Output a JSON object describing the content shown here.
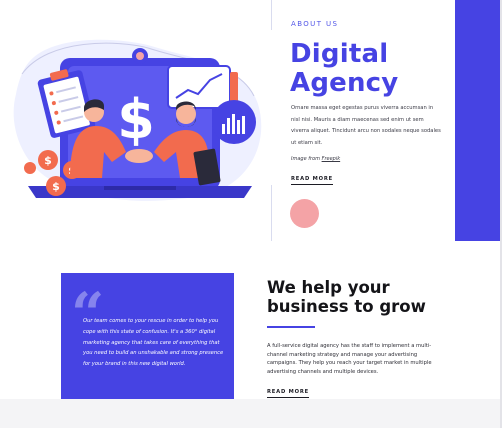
{
  "hero": {
    "eyebrow": "ABOUT US",
    "title": "Digital Agency",
    "body": "Ornare massa eget egestas purus viverra accumsan in nisl nisi. Mauris a diam maecenas sed enim ut sem viverra aliquet. Tincidunt arcu non sodales neque sodales ut etiam sit.",
    "credit_prefix": "Image from ",
    "credit_link": "Freepik",
    "read_more": "READ MORE"
  },
  "growth": {
    "quote": "Our team comes to your rescue in order to help you cope with this state of confusion. It's a 360° digital marketing agency that takes care of everything that you need to build an unshakable and strong presence for your brand in this new digital world.",
    "title": "We help your business to grow",
    "body": "A full-service digital agency has the staff to implement a multi-channel marketing strategy and manage your advertising campaigns. They help you reach your target market in multiple advertising channels and multiple devices.",
    "read_more": "READ MORE"
  },
  "colors": {
    "accent": "#4643e3",
    "pink": "#f4a3a6",
    "orange": "#f26b4e",
    "text_dark": "#141418"
  }
}
